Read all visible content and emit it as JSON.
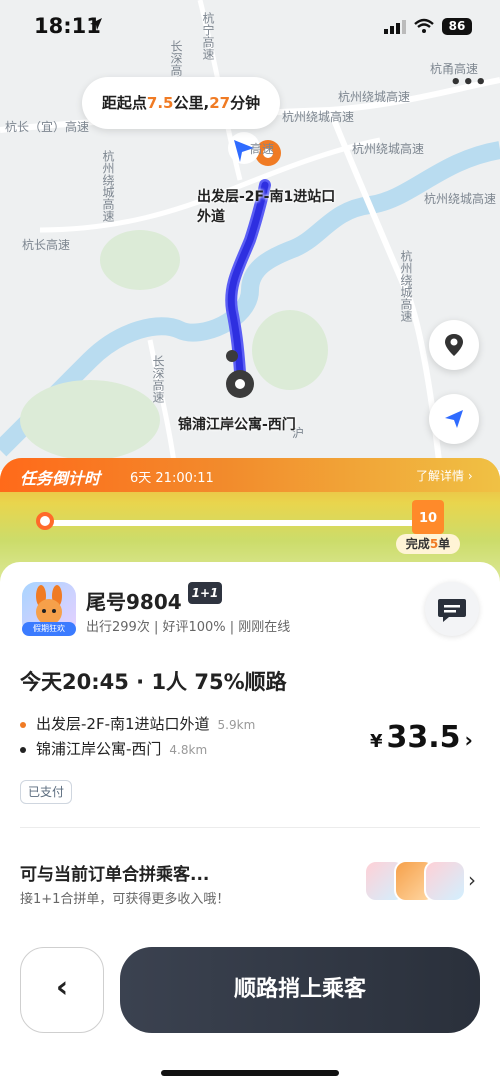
{
  "status_bar": {
    "time": "18:11",
    "battery": "86"
  },
  "map": {
    "eta": {
      "prefix": "距起点",
      "distance": "7.5",
      "mid": "公里,",
      "minutes": "27",
      "suffix": "分钟"
    },
    "labels": [
      "杭长（宜）高速",
      "杭州绕城高速",
      "杭州绕城高速",
      "杭甬高速",
      "杭州绕城高速",
      "杭州绕城高速",
      "杭长高速",
      "杭宁高速",
      "杭州绕城高速",
      "杭州绕城高速",
      "长深高速",
      "长深高速",
      "高速",
      "沪"
    ],
    "start_place": "出发层-2F-南1进站口外道",
    "end_place": "锦浦江岸公寓-西门"
  },
  "countdown": {
    "title": "任务倒计时",
    "time": "6天 21:00:11",
    "more": "了解详情 ›",
    "reward": "10",
    "tag_prefix": "完成",
    "tag_num": "5",
    "tag_suffix": "单"
  },
  "passenger": {
    "name": "尾号9804",
    "badge": "1+1",
    "stats": "出行299次 | 好评100% | 刚刚在线",
    "avatar_badge": "假期狂欢"
  },
  "trip": {
    "title": "今天20:45 · 1人 75%顺路",
    "start": {
      "name": "出发层-2F-南1进站口外道",
      "dist": "5.9km",
      "color": "#f07b24"
    },
    "end": {
      "name": "锦浦江岸公寓-西门",
      "dist": "4.8km",
      "color": "#222222"
    },
    "price_symbol": "¥",
    "price": "33.5",
    "chevron": "›",
    "paid": "已支付"
  },
  "merge": {
    "title": "可与当前订单合拼乘客...",
    "subtitle": "接1+1合拼单，可获得更多收入哦！",
    "chevron": "›"
  },
  "actions": {
    "back": "‹",
    "confirm": "顺路捎上乘客"
  }
}
